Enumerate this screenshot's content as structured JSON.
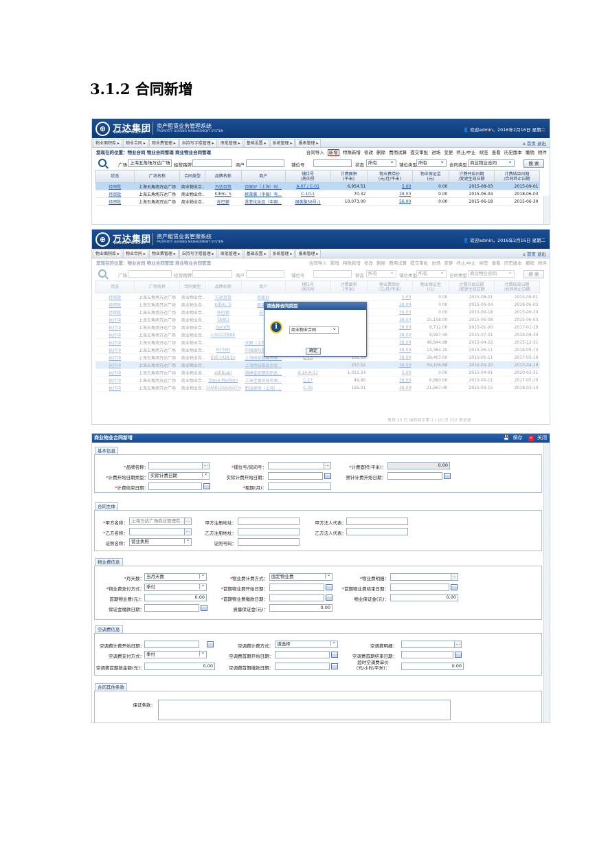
{
  "heading": "3.1.2 合同新增",
  "brand": {
    "logo_cn": "万达集团",
    "logo_en": "WANDA GROUP",
    "system_cn": "资产租赁业务管理系统",
    "system_en": "PROPERTY LEASING MANAGEMENT SYSTEM",
    "welcome": "欢迎admin，2016年2月16日 星期二"
  },
  "menu": [
    "物业面积库 ▸",
    "物业合同 ▸",
    "物业费管理 ▸",
    "自持写字楼管理 ▸",
    "审批管理 ▸",
    "基础设置 ▸",
    "系统管理 ▸",
    "报表管理 ▸"
  ],
  "menu_right": "首页 退出",
  "breadcrumb": "您现在的位置：物业合同 物业合同管理 商业物业合同管理",
  "toolbar": {
    "import": "合同导入",
    "add": "新增",
    "special": "特殊新增",
    "edit": "修改",
    "delete": "删除",
    "trial": "费用试算",
    "submit": "提交审批",
    "enter": "进场",
    "change": "变更",
    "terminate": "终止/中止",
    "renew": "续签",
    "view": "查看",
    "history": "历史版本",
    "revoke": "撤销",
    "attach": "附件"
  },
  "filters": {
    "plaza_label": "广场",
    "plaza_value": "上海五角场万达广场",
    "mgmt_label": "经营路牌",
    "tenant_label": "商户",
    "berth_label": "铺位号",
    "status_label": "状态",
    "status_value": "所有",
    "berth_type_label": "铺位类型",
    "berth_type_value": "所有",
    "contract_type_label": "合同类型",
    "contract_type_value": "商业物业合同",
    "search": "搜 索"
  },
  "grid_headers": [
    "状态",
    "广场名称",
    "合同类型",
    "品牌名称",
    "商户",
    "铺位号\n/房间号",
    "计费面积\n(平米)",
    "物业费单价\n(元/月/平米)",
    "物业保证金\n(元)",
    "计费开始日期\n/变更生效日期",
    "计费结束日期\n/合同终止日期"
  ],
  "grid_rows": [
    [
      "待审批",
      "上海五角场万达广场",
      "商业物业合...",
      "万达百货",
      "百家好（上海）时...",
      "A-07 / C-01",
      "6,954.51",
      "5.00",
      "0.00",
      "2015-08-03",
      "2015-09-01"
    ],
    [
      "待审批",
      "上海五角场万达广场",
      "商业物业合...",
      "KIEHL`S",
      "欧莱雅（中国）有...",
      "C-10-1",
      "70.32",
      "28.00",
      "0.00",
      "2015-06-04",
      "2018-06-03"
    ],
    [
      "待审批",
      "上海五角场万达广场",
      "商业物业合...",
      "孙巴顿",
      "苏菲化妆品（中国...",
      "国美路58号-1",
      "10,073.00",
      "56.00",
      "0.00",
      "2015-06-18",
      "2015-06-30"
    ]
  ],
  "grid2_rows": [
    [
      "待审批",
      "上海五角场万达广场",
      "商业物业合...",
      "万达百货",
      "百家好",
      "",
      "",
      "5.00",
      "0.00",
      "2015-08-01",
      "2015-09-01"
    ],
    [
      "待审批",
      "上海五角场万达广场",
      "商业物业合...",
      "KIEHL`S",
      "欧莱雅",
      "",
      "",
      "28.00",
      "0.00",
      "2015-06-04",
      "2018-06-03"
    ],
    [
      "待审批",
      "上海五角场万达广场",
      "商业物业合...",
      "孙巴顿",
      "苏菲",
      "",
      "",
      "56.00",
      "0.00",
      "2015-06-18",
      "2015-06-30"
    ],
    [
      "执行中",
      "上海五角场万达广场",
      "商业物业合...",
      "TANCI",
      "",
      "",
      "",
      "38.00",
      "15,158.00",
      "2015-05-08",
      "2015-06-03"
    ],
    [
      "执行中",
      "上海五角场万达广场",
      "商业物业合...",
      "benefit",
      "",
      "",
      "",
      "38.00",
      "9,712.00",
      "2015-01-20",
      "2017-01-19"
    ],
    [
      "执行中",
      "上海五角场万达广场",
      "商业物业合...",
      "L'OCCITANE",
      "",
      "",
      "",
      "38.00",
      "9,997.40",
      "2015-07-01",
      "2018-06-30"
    ],
    [
      "执行中",
      "上海五角场万达广场",
      "商业物业合...",
      "",
      "沃丽（上海）服饰...",
      "A-56",
      "147.82",
      "38.00",
      "48,844.88",
      "2015-04-22",
      "2015-12-31"
    ],
    [
      "执行中",
      "上海五角场万达广场",
      "商业物业合...",
      "FITTER",
      "中国国际服装设计...",
      "C-21",
      "102.71",
      "38.00",
      "14,382.20",
      "2015-05-11",
      "2016-05-10"
    ],
    [
      "执行中",
      "上海五角场万达广场",
      "商业物业合...",
      "EVE HUB Ex",
      "上海物城服装贸易...",
      "C-13",
      "131.55",
      "38.00",
      "18,407.00",
      "2015-05-11",
      "2017-05-10"
    ],
    [
      "执行中",
      "上海五角场万达广场",
      "商业物业合...",
      "",
      "上海物城服装贸易...",
      "",
      "257.52",
      "38.00",
      "34,106.88",
      "2015-04-20",
      "2015-04-19"
    ],
    [
      "执行中",
      "上海五角场万达广场",
      "商业物业合...",
      "ashbuan",
      "福建省安踏纺织品...",
      "A-16-A-17",
      "1,011.24",
      "5.00",
      "0.00",
      "2015-04-01",
      "2020-03-31"
    ],
    [
      "执行中",
      "上海五角场万达广场",
      "商业物业合...",
      "Steve Madden",
      "上海宝源贸易有限...",
      "C-17",
      "49.90",
      "38.00",
      "6,880.00",
      "2015-05-11",
      "2017-05-10"
    ],
    [
      "执行中",
      "上海五角场万达广场",
      "商业物业合...",
      "CHARLES&KEITH",
      "新加坡恒（上海）...",
      "C-26",
      "156.01",
      "38.00",
      "21,967.40",
      "2015-03-15",
      "2018-03-14"
    ]
  ],
  "pager": "每页 15 行 当前显示第 1 / 10 页 132 条记录",
  "modal": {
    "title": "请选择合同类型",
    "select": "商业物业合同",
    "ok": "确定"
  },
  "form": {
    "title": "商业物业合同新增",
    "save": "保存",
    "close": "关闭",
    "sec_basic": "基本信息",
    "sec_party": "合同主体",
    "sec_fee": "物业费信息",
    "sec_ac": "空调费信息",
    "sec_other": "合同其他条款",
    "brand_name": "品牌名称：",
    "berth_no": "铺位号/房间号：",
    "area": "计费面积(平米)：",
    "area_value": "0.00",
    "start_type": "计费开始日期类型：",
    "start_type_value": "实际计费日期",
    "actual_start": "实际计费开始日期：",
    "est_start": "预计计费开始日期：",
    "end_date": "计费结束日期：",
    "lease_term": "租期(月)：",
    "party_a": "甲方名称：",
    "party_a_value": "上海万达广场商业管理有...",
    "a_reg_addr": "甲方注册地址：",
    "a_legal": "甲方法人代表：",
    "party_b": "乙方名称：",
    "b_reg_addr": "乙方注册地址：",
    "b_legal": "乙方法人代表：",
    "cert_type": "证照名称：",
    "cert_type_value": "营业执照",
    "cert_no": "证照号码：",
    "month_days": "月天数：",
    "month_days_value": "当月天数",
    "fee_method": "物业费计费方式：",
    "fee_method_value": "固定物业费",
    "fee_detail": "物业费明细：",
    "pay_method": "物业费支付方式：",
    "pay_method_value": "季付",
    "first_start": "首期物业费开始日期：",
    "first_end": "首期物业费结束日期：",
    "first_fee": "首期物业费(元)：",
    "first_fee_value": "0.00",
    "first_pay_date": "首期物业费缴款日期：",
    "deposit": "物业保证金(元)：",
    "deposit_value": "0.00",
    "deposit_date": "保证金缴款日期：",
    "quality_deposit": "质量保证金(元)：",
    "quality_value": "0.00",
    "ac_start": "空调费计费开始日期：",
    "ac_method": "空调费计费方式：",
    "ac_method_value": "请选择",
    "ac_detail": "空调费明细：",
    "ac_pay": "空调费支付方式：",
    "ac_pay_value": "季付",
    "ac_first_start": "空调费首期开始日期：",
    "ac_first_end": "空调费首期结束日期：",
    "ac_first_fee": "空调费首期款金额(元)：",
    "ac_first_fee_value": "0.00",
    "ac_first_pay_date": "空调费首期缴款日期：",
    "ac_overtime": "超时空调费单价",
    "ac_overtime_unit": "(元/小时/平米)：",
    "ac_overtime_value": "0.00",
    "deposit_terms": "保证条款："
  }
}
